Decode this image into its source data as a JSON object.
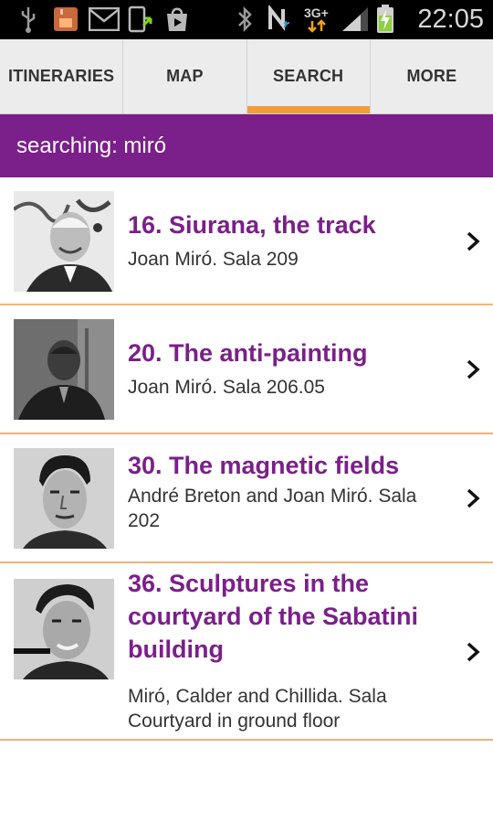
{
  "status_bar": {
    "time": "22:05",
    "network": "3G+",
    "icons": [
      "usb-icon",
      "sd-card-icon",
      "gmail-icon",
      "phone-update-icon",
      "store-icon",
      "bluetooth-icon",
      "nfc-icon",
      "network-3g-icon",
      "signal-icon",
      "battery-charging-icon"
    ]
  },
  "tabs": [
    {
      "label": "ITINERARIES",
      "active": false
    },
    {
      "label": "MAP",
      "active": false
    },
    {
      "label": "SEARCH",
      "active": true
    },
    {
      "label": "MORE",
      "active": false
    }
  ],
  "search": {
    "header": "searching: miró"
  },
  "results": [
    {
      "title": "16. Siurana, the track",
      "subtitle": "Joan Miró. Sala 209",
      "thumbnail": "portrait-joan-miro-smiling"
    },
    {
      "title": "20. The anti-painting",
      "subtitle": "Joan Miró. Sala 206.05",
      "thumbnail": "portrait-joan-miro-dark"
    },
    {
      "title": "30. The magnetic fields",
      "subtitle": "André Breton and Joan Miró. Sala 202",
      "thumbnail": "portrait-andre-breton"
    },
    {
      "title": "36. Sculptures in the courtyard of the Sabatini building",
      "subtitle": "Miró, Calder and Chillida. Sala Courtyard in ground floor",
      "thumbnail": "portrait-sculptor"
    }
  ],
  "colors": {
    "accent_purple": "#7b1f8a",
    "tab_underline": "#f39c3b",
    "divider": "#f2b37a"
  }
}
